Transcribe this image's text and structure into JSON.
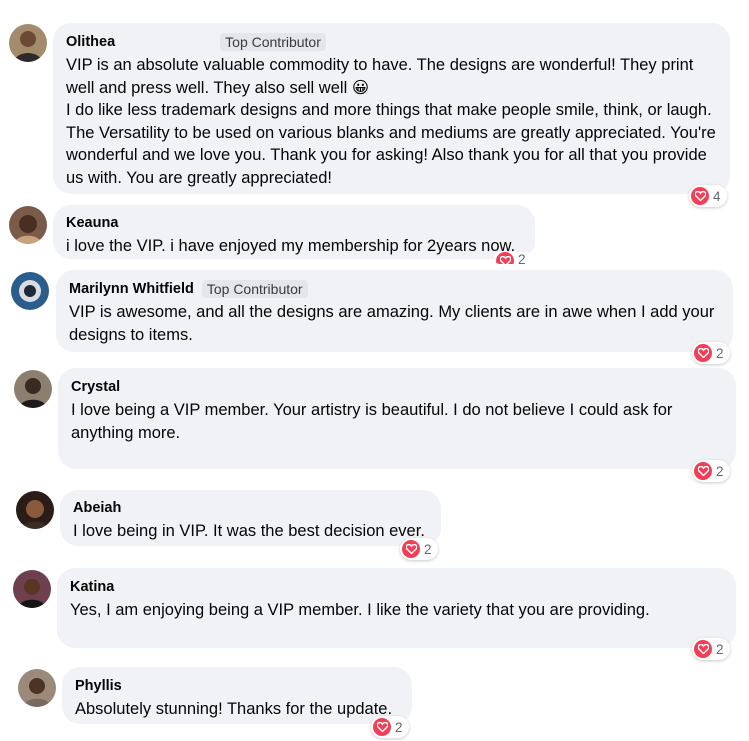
{
  "colors": {
    "bubble": "#f0f2f5",
    "reaction_heart": "#f33e58",
    "badge_bg": "#e4e6eb",
    "muted_text": "#65676b"
  },
  "comments": [
    {
      "author": "Olithea",
      "badge": "Top Contributor",
      "paragraphs": [
        "VIP is an absolute valuable commodity to have. The designs are wonderful! They print well and press well. They also sell well 😀",
        "I do like less trademark designs and more things that make people smile, think, or laugh. The Versatility to be used on various blanks and mediums are greatly appreciated. You're wonderful and we love you. Thank you for asking! Also thank you for all that you provide us with. You are greatly appreciated!"
      ],
      "reaction_icon": "heart-icon",
      "reaction_count": "4"
    },
    {
      "author": "Keauna",
      "badge": "",
      "paragraphs": [
        "i love the VIP. i have enjoyed my membership for 2years now."
      ],
      "reaction_icon": "heart-icon",
      "reaction_count": "2"
    },
    {
      "author": "Marilynn Whitfield",
      "badge": "Top Contributor",
      "paragraphs": [
        "VIP is awesome, and all the designs are amazing. My clients are in awe when I add your designs to items."
      ],
      "reaction_icon": "heart-icon",
      "reaction_count": "2"
    },
    {
      "author": "Crystal",
      "badge": "",
      "paragraphs": [
        "I love being a VIP member. Your artistry is beautiful. I do not believe I could ask for anything more."
      ],
      "reaction_icon": "heart-icon",
      "reaction_count": "2"
    },
    {
      "author": "Abeiah",
      "badge": "",
      "paragraphs": [
        "I love being in VIP. It was the best decision ever."
      ],
      "reaction_icon": "heart-icon",
      "reaction_count": "2"
    },
    {
      "author": "Katina",
      "badge": "",
      "paragraphs": [
        "Yes, I am enjoying being a VIP member. I like the variety that you are providing."
      ],
      "reaction_icon": "heart-icon",
      "reaction_count": "2"
    },
    {
      "author": "Phyllis",
      "badge": "",
      "paragraphs": [
        "Absolutely stunning! Thanks for the update."
      ],
      "reaction_icon": "heart-icon",
      "reaction_count": "2"
    }
  ]
}
